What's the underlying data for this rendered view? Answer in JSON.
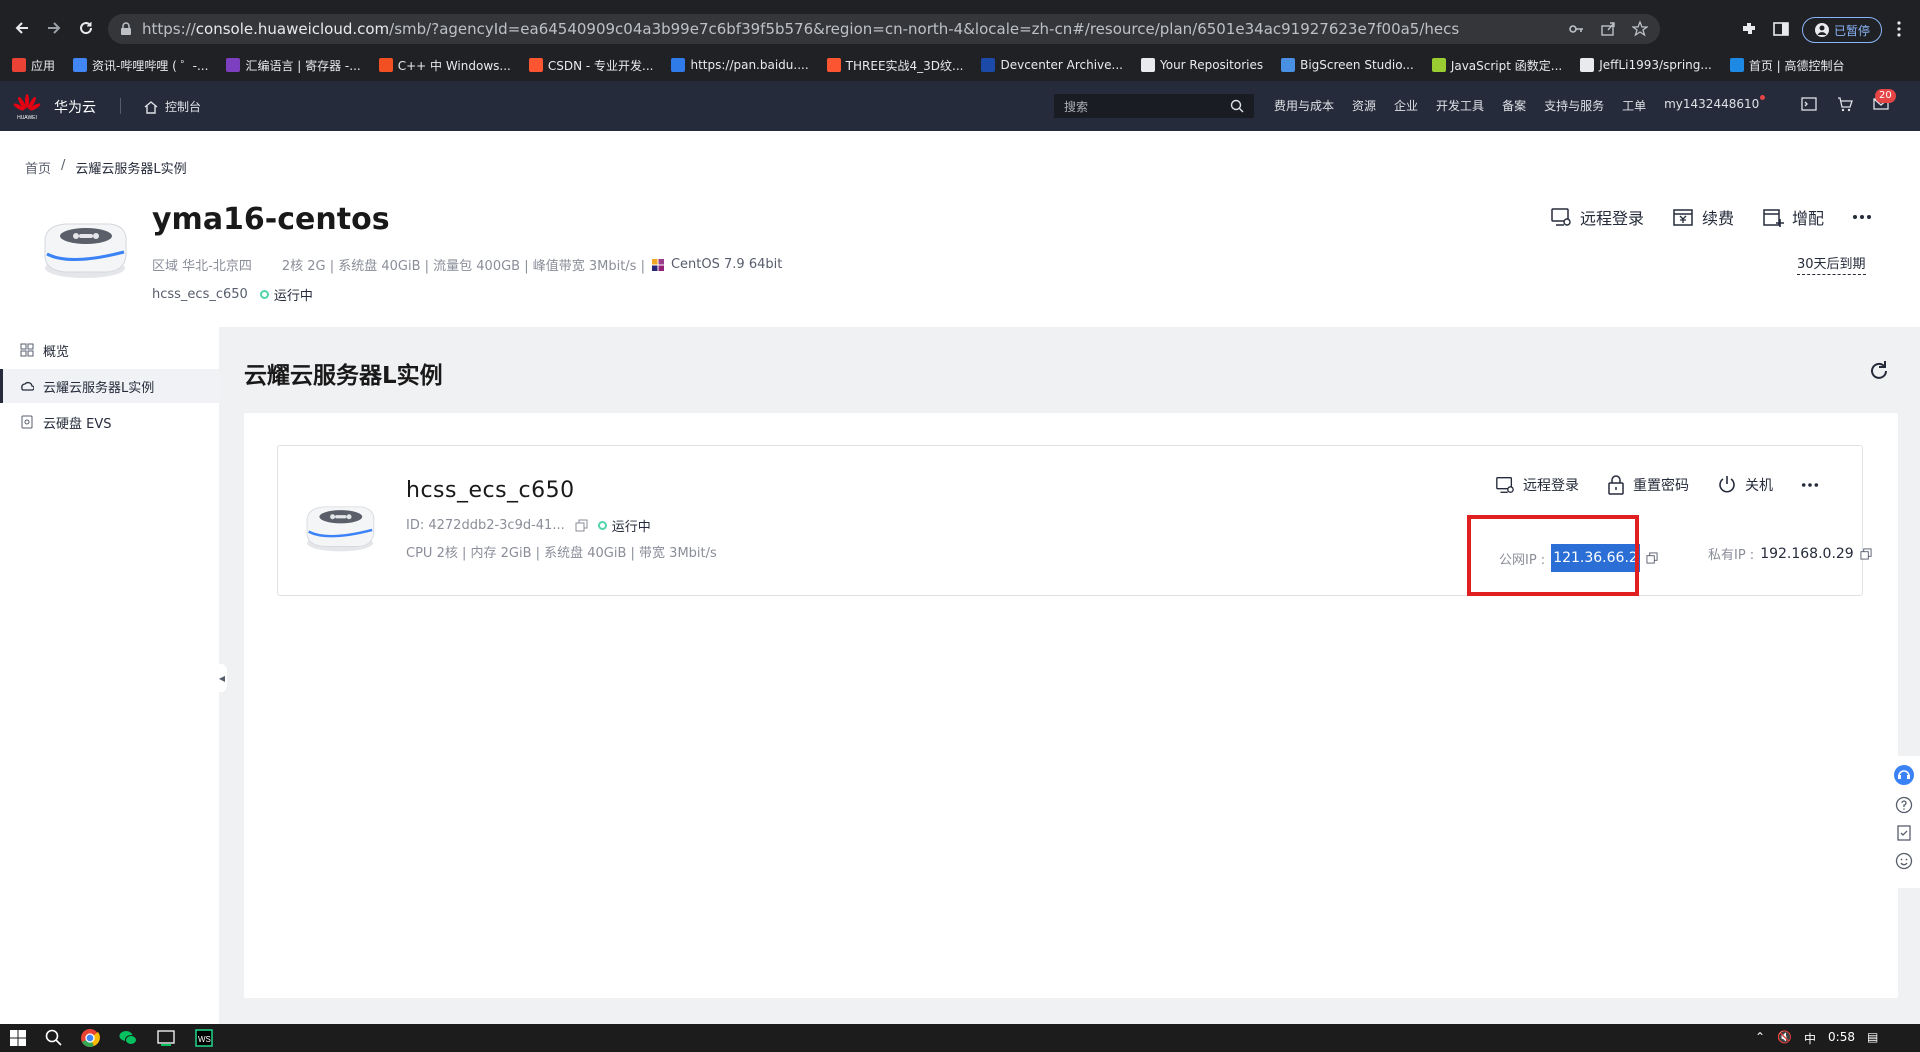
{
  "browser": {
    "url_prefix": "https://",
    "url_host": "console.huaweicloud.com",
    "url_path": "/smb/?agencyId=ea64540909c04a3b99e7c6bf39f5b576&region=cn-north-4&locale=zh-cn#/resource/plan/6501e34ac91927623e7f00a5/hecs",
    "profile_label": "已暂停",
    "bookmarks": [
      {
        "label": "应用",
        "color": "#ea4335"
      },
      {
        "label": "资讯-哔哩哔哩 ( ゜-...",
        "color": "#4285f4"
      },
      {
        "label": "汇编语言 | 寄存器 -...",
        "color": "#7b3fbf"
      },
      {
        "label": "C++ 中 Windows...",
        "color": "#f25022"
      },
      {
        "label": "CSDN - 专业开发...",
        "color": "#fc5531"
      },
      {
        "label": "https://pan.baidu....",
        "color": "#2f7bea"
      },
      {
        "label": "THREE实战4_3D纹...",
        "color": "#fc5531"
      },
      {
        "label": "Devcenter Archive...",
        "color": "#1c4aa8"
      },
      {
        "label": "Your Repositories",
        "color": "#e8eaed"
      },
      {
        "label": "BigScreen Studio...",
        "color": "#4a90e2"
      },
      {
        "label": "JavaScript 函数定...",
        "color": "#9acd32"
      },
      {
        "label": "JeffLi1993/spring...",
        "color": "#e8eaed"
      },
      {
        "label": "首页 | 高德控制台",
        "color": "#1e88e5"
      }
    ]
  },
  "header": {
    "brand": "华为云",
    "logo_text": "HUAWEI",
    "console": "控制台",
    "search_placeholder": "搜索",
    "nav": [
      "费用与成本",
      "资源",
      "企业",
      "开发工具",
      "备案",
      "支持与服务",
      "工单",
      "my1432448610"
    ],
    "mail_badge": "20"
  },
  "instance": {
    "breadcrumb_home": "首页",
    "breadcrumb_sep": "/",
    "breadcrumb_current": "云耀云服务器L实例",
    "title": "yma16-centos",
    "region": "区域 华北-北京四",
    "spec": "2核  2G | 系统盘 40GiB | 流量包 400GB | 峰值带宽 3Mbit/s |",
    "os": "CentOS 7.9 64bit",
    "host": "hcss_ecs_c650",
    "status": "运行中",
    "actions": [
      "远程登录",
      "续费",
      "增配"
    ],
    "expire": "30天后到期"
  },
  "sidebar": {
    "items": [
      "概览",
      "云耀云服务器L实例",
      "云硬盘 EVS"
    ]
  },
  "main": {
    "title": "云耀云服务器L实例",
    "card": {
      "name": "hcss_ecs_c650",
      "id": "ID: 4272ddb2-3c9d-41...",
      "status": "运行中",
      "spec": "CPU 2核 | 内存 2GiB | 系统盘 40GiB | 带宽 3Mbit/s",
      "actions": [
        "远程登录",
        "重置密码",
        "关机"
      ],
      "public_ip_label": "公网IP :",
      "public_ip": "121.36.66.2",
      "private_ip_label": "私有IP :",
      "private_ip": "192.168.0.29"
    }
  },
  "taskbar": {
    "lang": "中",
    "time": "0:58"
  },
  "colors": {
    "header_bg": "#252b3a",
    "status_green": "#50d4ab",
    "highlight_red": "#e02020",
    "selection_blue": "#2b6fd6"
  }
}
